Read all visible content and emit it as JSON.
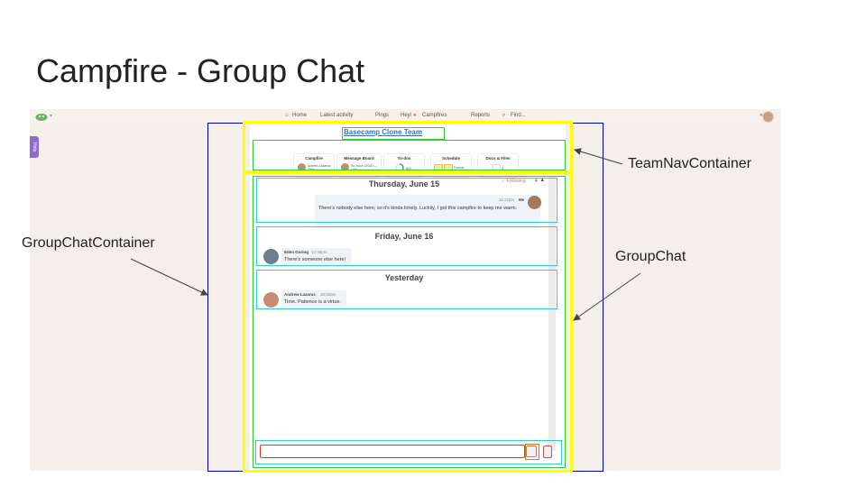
{
  "slide": {
    "title": "Campfire - Group Chat"
  },
  "topnav": {
    "home": "Home",
    "latest_activity": "Latest activity",
    "pings": "Pings",
    "hey": "Hey!",
    "campfires": "Campfires",
    "reports": "Reports",
    "find": "Find..."
  },
  "help_tab": "Help",
  "team": {
    "name": "Basecamp Clone Team",
    "tools": [
      {
        "title": "Campfire",
        "detail": "Andrew Lazarus Time..."
      },
      {
        "title": "Message Board",
        "detail": "So much CRUD — Last"
      },
      {
        "title": "To-dos",
        "detail": "5/6"
      },
      {
        "title": "Schedule",
        "detail": "Format..."
      },
      {
        "title": "Docs & Files",
        "detail": "3"
      }
    ]
  },
  "chat": {
    "following": "✓ Following",
    "follower_count": "4",
    "days": [
      {
        "heading": "Thursday, June 15",
        "author": "Me",
        "time": "11:17pm",
        "text": "There's nobody else here, so it's kinda lonely. Luckily, I got this campfire to keep me warm."
      },
      {
        "heading": "Friday, June 16",
        "author": "Eden Goring",
        "time": "12:45pm",
        "text": "There's someone else here!"
      },
      {
        "heading": "Yesterday",
        "author": "Andrew Lazarus",
        "time": "10:35am",
        "text": "Time. Patience is a virtue."
      }
    ],
    "input_placeholder": ""
  },
  "annotations": {
    "team_nav": "TeamNavContainer",
    "group_chat_container": "GroupChatContainer",
    "group_chat": "GroupChat"
  },
  "colors": {
    "container_outline": "#0000aa",
    "team_nav_outline": "#ffff00",
    "green_outline": "#33cc33",
    "cyan_outline": "#33cccc",
    "help_tab": "#8d6bd1",
    "link": "#3a6fc2"
  }
}
